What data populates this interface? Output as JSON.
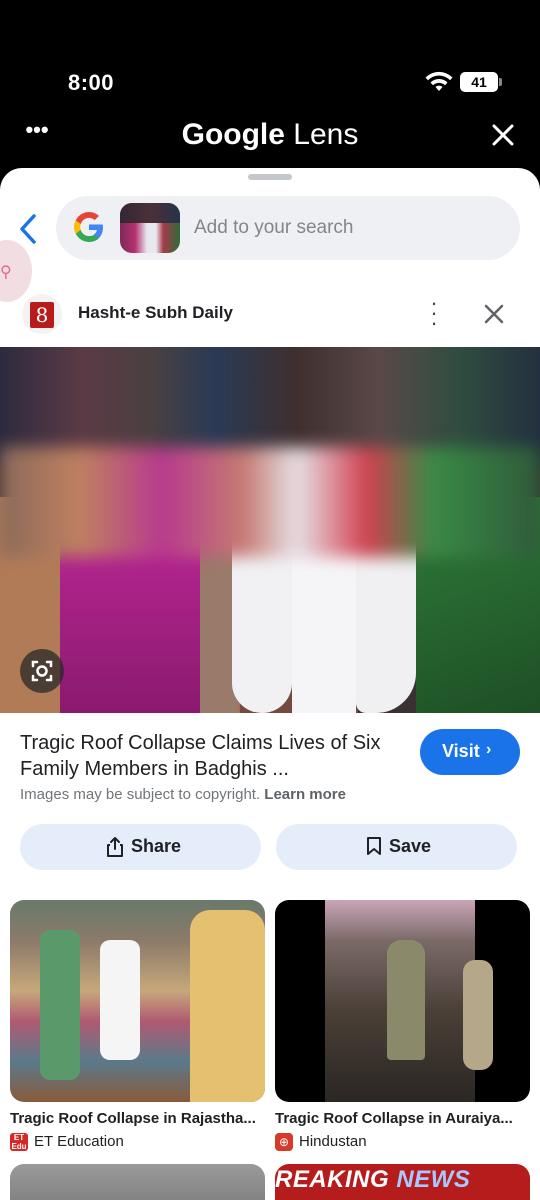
{
  "status_bar": {
    "time": "8:00",
    "battery": "41"
  },
  "header": {
    "title_part1": "Google",
    "title_part2": " Lens"
  },
  "search": {
    "placeholder": "Add to your search"
  },
  "source": {
    "logo_text": "8",
    "name": "Hasht-e Subh Daily"
  },
  "result": {
    "title": "Tragic Roof Collapse Claims Lives of Six Family Members in Badghis ...",
    "visit_label": "Visit",
    "copyright_text": "Images may be subject to copyright.",
    "learn_more": "Learn more"
  },
  "actions": {
    "share_label": "Share",
    "save_label": "Save"
  },
  "related": [
    {
      "title": "Tragic Roof Collapse in Rajastha...",
      "source": "ET Education",
      "favicon": "ET"
    },
    {
      "title": "Tragic Roof Collapse in Auraiya...",
      "source": "Hindustan",
      "favicon": "H"
    }
  ],
  "related_more": {
    "banner_part1": "REAKING ",
    "banner_part2": "NEWS"
  },
  "colors": {
    "accent": "#1a73e8",
    "pill": "#e6edfa",
    "search_bg": "#eef0f4"
  }
}
